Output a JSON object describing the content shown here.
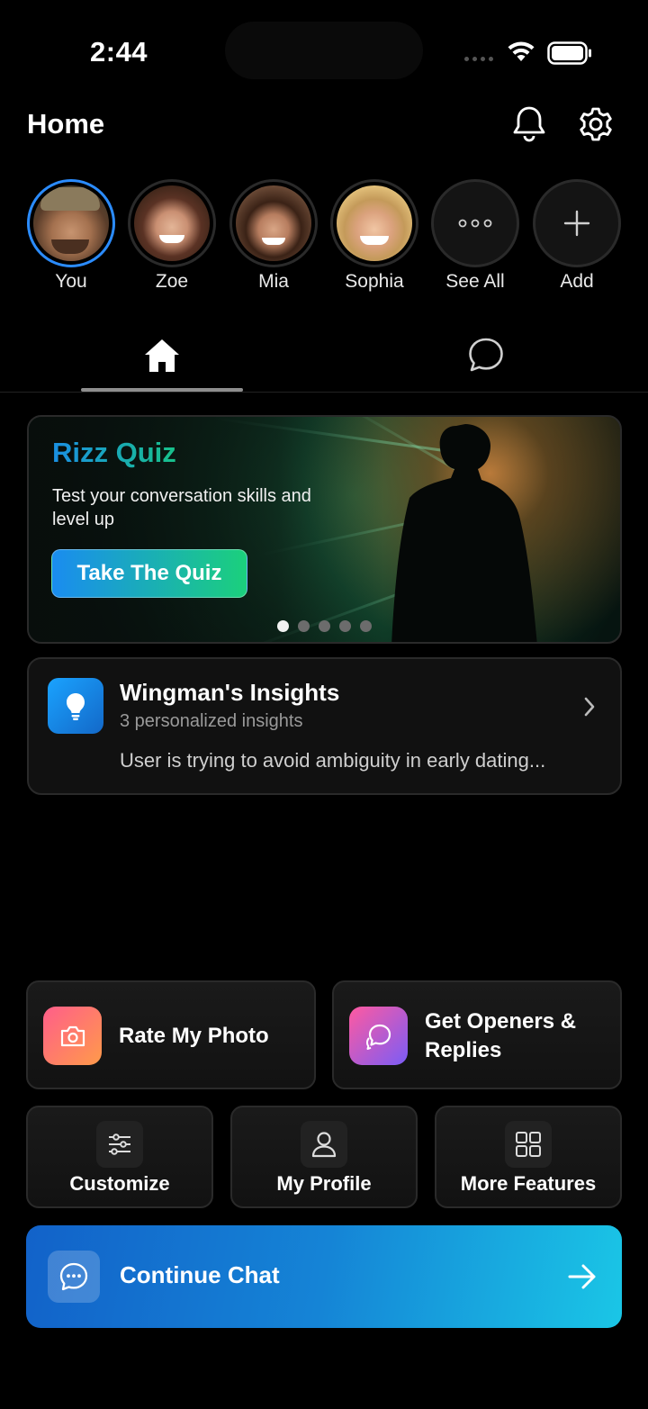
{
  "status_bar": {
    "time": "2:44"
  },
  "header": {
    "title": "Home"
  },
  "stories": [
    {
      "label": "You"
    },
    {
      "label": "Zoe"
    },
    {
      "label": "Mia"
    },
    {
      "label": "Sophia"
    },
    {
      "label": "See All"
    },
    {
      "label": "Add"
    }
  ],
  "tabs": {
    "active": "home"
  },
  "banner": {
    "title": "Rizz Quiz",
    "subtitle": "Test your conversation skills and level up",
    "button_label": "Take The Quiz",
    "page_index": 1,
    "page_count": 5
  },
  "insights": {
    "title": "Wingman's Insights",
    "count_text": "3 personalized insights",
    "preview": "User is trying to avoid ambiguity in early dating..."
  },
  "features": {
    "rate_photo": "Rate My Photo",
    "openers_line1": "Get Openers &",
    "openers_line2": "Replies",
    "customize": "Customize",
    "my_profile": "My Profile",
    "more_features": "More Features"
  },
  "continue_chat": {
    "label": "Continue Chat"
  },
  "colors": {
    "accent_blue": "#2b8cff",
    "quiz_gradient_start": "#1a8cf0",
    "quiz_gradient_end": "#1bd07c",
    "rate_photo_icon": "#ff6a6a",
    "openers_icon": "#8c5cf6"
  },
  "icons": [
    "bell-icon",
    "gear-icon",
    "home-icon",
    "chat-bubble-icon",
    "lightbulb-icon",
    "chevron-right-icon",
    "camera-icon",
    "chat-icon",
    "sliders-icon",
    "user-icon",
    "grid-icon",
    "message-dots-icon",
    "arrow-right-icon"
  ]
}
